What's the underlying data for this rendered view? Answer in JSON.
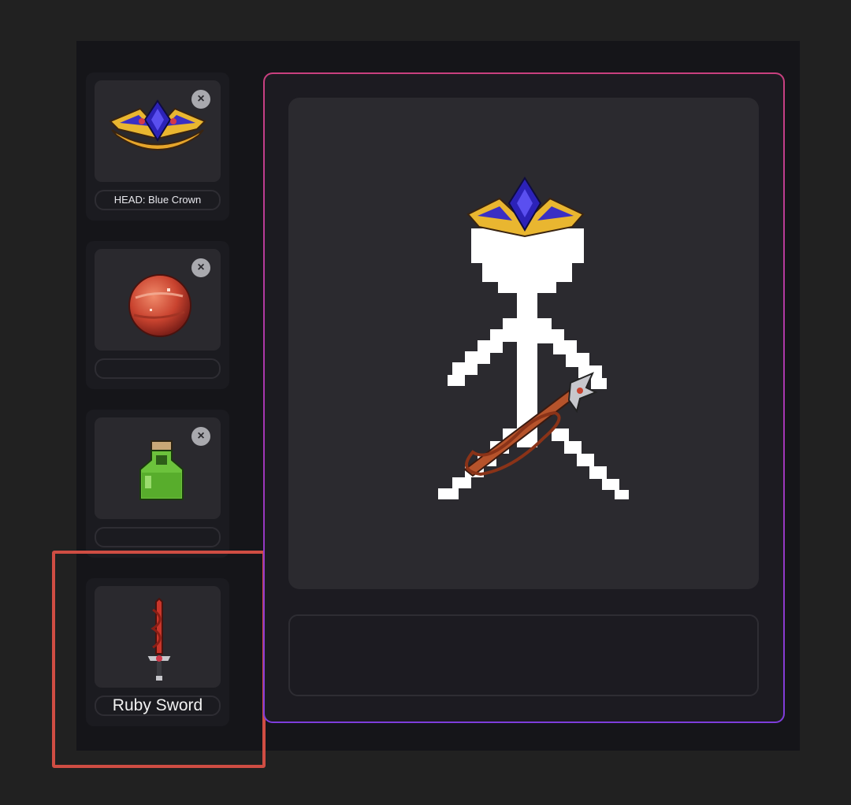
{
  "equipment_slots": [
    {
      "label": "HEAD: Blue Crown",
      "item_icon": "blue-crown-icon",
      "removable": true
    },
    {
      "label": "",
      "item_icon": "red-orb-icon",
      "removable": true
    },
    {
      "label": "",
      "item_icon": "green-potion-icon",
      "removable": true
    },
    {
      "label": "Ruby Sword",
      "item_icon": "ruby-sword-icon",
      "removable": false
    }
  ],
  "remove_symbol": "×",
  "preview": {
    "character": "stick-figure",
    "equipped": [
      "blue-crown-icon",
      "ruby-sword-icon"
    ],
    "description": ""
  },
  "colors": {
    "background": "#212121",
    "panel": "#151519",
    "highlight": "#cf4d43",
    "frame_gradient": [
      "#c9407f",
      "#7e3ddc"
    ]
  }
}
